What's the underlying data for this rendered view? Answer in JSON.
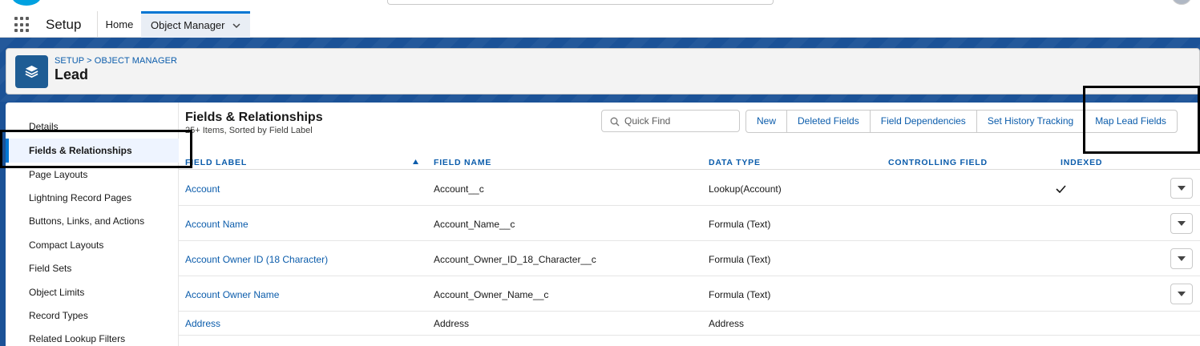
{
  "nav": {
    "app_name": "Setup",
    "tabs": [
      {
        "label": "Home"
      },
      {
        "label": "Object Manager"
      }
    ]
  },
  "header": {
    "breadcrumb": "SETUP > OBJECT MANAGER",
    "title": "Lead",
    "icon": "layers-icon"
  },
  "sidebar": {
    "items": [
      {
        "label": "Details"
      },
      {
        "label": "Fields & Relationships",
        "active": true
      },
      {
        "label": "Page Layouts"
      },
      {
        "label": "Lightning Record Pages"
      },
      {
        "label": "Buttons, Links, and Actions"
      },
      {
        "label": "Compact Layouts"
      },
      {
        "label": "Field Sets"
      },
      {
        "label": "Object Limits"
      },
      {
        "label": "Record Types"
      },
      {
        "label": "Related Lookup Filters"
      }
    ]
  },
  "section": {
    "title": "Fields & Relationships",
    "subtitle": "25+ Items, Sorted by Field Label"
  },
  "quickfind": {
    "placeholder": "Quick Find"
  },
  "buttons": [
    {
      "label": "New"
    },
    {
      "label": "Deleted Fields"
    },
    {
      "label": "Field Dependencies"
    },
    {
      "label": "Set History Tracking"
    },
    {
      "label": "Map Lead Fields"
    }
  ],
  "table": {
    "columns": [
      "FIELD LABEL",
      "FIELD NAME",
      "DATA TYPE",
      "CONTROLLING FIELD",
      "INDEXED"
    ],
    "rows": [
      {
        "label": "Account",
        "name": "Account__c",
        "type": "Lookup(Account)",
        "controlling": "",
        "indexed": true
      },
      {
        "label": "Account Name",
        "name": "Account_Name__c",
        "type": "Formula (Text)",
        "controlling": "",
        "indexed": false
      },
      {
        "label": "Account Owner ID (18 Character)",
        "name": "Account_Owner_ID_18_Character__c",
        "type": "Formula (Text)",
        "controlling": "",
        "indexed": false
      },
      {
        "label": "Account Owner Name",
        "name": "Account_Owner_Name__c",
        "type": "Formula (Text)",
        "controlling": "",
        "indexed": false
      },
      {
        "label": "Address",
        "name": "Address",
        "type": "Address",
        "controlling": "",
        "indexed": false
      }
    ]
  },
  "colors": {
    "brand_blue": "#0176d3",
    "link_blue": "#0b5cab",
    "band_blue": "#1b5297"
  }
}
